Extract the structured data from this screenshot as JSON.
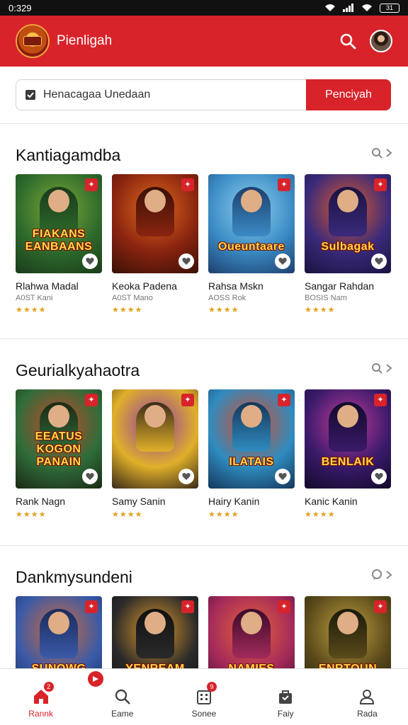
{
  "status_bar": {
    "time": "0:329",
    "battery": "31"
  },
  "header": {
    "app_title": "Pienligah"
  },
  "search": {
    "placeholder": "Henacagaa Unedaan",
    "button_label": "Penciyah"
  },
  "sections": [
    {
      "title": "Kantiagamdba",
      "more_icon": "search-icon",
      "cards": [
        {
          "name": "Rlahwa Madal",
          "sub": "A0ST  Kani",
          "stars": "★★★★",
          "art": "FIAKANS EANBAANS",
          "colors": [
            "#2e6a2c",
            "#7da835",
            "#1a3b1a"
          ]
        },
        {
          "name": "Keoka Padena",
          "sub": "A0ST  Mano",
          "stars": "★★★★",
          "art": "",
          "colors": [
            "#8a2410",
            "#e26b1a",
            "#3a1006"
          ]
        },
        {
          "name": "Rahsa Mskn",
          "sub": "AOSS  Rok",
          "stars": "★★★★",
          "art": "Oueuntaare",
          "colors": [
            "#3a8bc4",
            "#8fd0ef",
            "#1d3f6e"
          ]
        },
        {
          "name": "Sangar Rahdan",
          "sub": "BOSIS  Nam",
          "stars": "★★★★",
          "art": "Sulbagak",
          "colors": [
            "#3a2a7a",
            "#e05a2a",
            "#1a1240"
          ]
        }
      ]
    },
    {
      "title": "Geurialkyahaotra",
      "more_icon": "search-icon",
      "cards": [
        {
          "name": "Rank Nagn",
          "sub": "",
          "stars": "★★★★",
          "art": "EEATUS KOGON PANAIN",
          "colors": [
            "#2f6d3a",
            "#c7472a",
            "#1c2a14"
          ]
        },
        {
          "name": "Samy Sanin",
          "sub": "",
          "stars": "★★★★",
          "art": "",
          "colors": [
            "#e0b02a",
            "#8d3aa6",
            "#3a2a18"
          ]
        },
        {
          "name": "Hairy Kanin",
          "sub": "",
          "stars": "★★★★",
          "art": "ILATAIS",
          "colors": [
            "#2f8cc0",
            "#d94a2a",
            "#15375a"
          ]
        },
        {
          "name": "Kanic Kanin",
          "sub": "",
          "stars": "★★★★",
          "art": "BENLAIK",
          "colors": [
            "#3a1a6a",
            "#c03a9a",
            "#120a2a"
          ]
        }
      ]
    },
    {
      "title": "Dankmysundeni",
      "more_icon": "comment-icon",
      "cards": [
        {
          "name": "",
          "sub": "",
          "stars": "",
          "art": "SUNOWG",
          "colors": [
            "#3a5aa8",
            "#d06a3a",
            "#1a2a5a"
          ]
        },
        {
          "name": "",
          "sub": "",
          "stars": "",
          "art": "YENREAM",
          "colors": [
            "#2a2a2a",
            "#e09a2a",
            "#111"
          ]
        },
        {
          "name": "",
          "sub": "",
          "stars": "",
          "art": "NAMIES",
          "colors": [
            "#a32a5a",
            "#e8623a",
            "#3a0a2a"
          ]
        },
        {
          "name": "",
          "sub": "",
          "stars": "",
          "art": "ENRTOUN",
          "colors": [
            "#5a4a1a",
            "#c0a040",
            "#1a1a0a"
          ]
        }
      ]
    }
  ],
  "bottom_nav": [
    {
      "label": "Rannk",
      "icon": "home-icon",
      "badge": "2",
      "active": true
    },
    {
      "label": "Eame",
      "icon": "search-icon",
      "badge": "",
      "active": false
    },
    {
      "label": "Sonee",
      "icon": "building-icon",
      "badge": "9",
      "active": false
    },
    {
      "label": "Faiy",
      "icon": "bag-icon",
      "badge": "",
      "active": false
    },
    {
      "label": "Rada",
      "icon": "profile-icon",
      "badge": "",
      "active": false
    }
  ]
}
